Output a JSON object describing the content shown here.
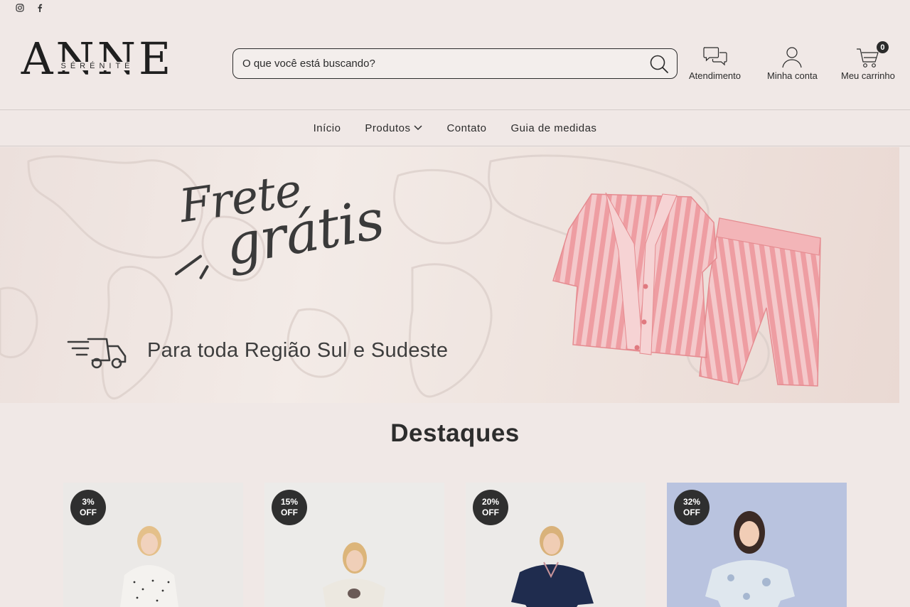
{
  "social": {
    "instagram_icon": "instagram-icon",
    "facebook_icon": "facebook-icon"
  },
  "logo": {
    "main": "ANNE",
    "sub": "SÉRÉNITÉ"
  },
  "search": {
    "placeholder": "O que você está buscando?"
  },
  "header": {
    "support_label": "Atendimento",
    "account_label": "Minha conta",
    "cart_label": "Meu carrinho",
    "cart_count": "0"
  },
  "nav": {
    "items": [
      {
        "label": "Início"
      },
      {
        "label": "Produtos"
      },
      {
        "label": "Contato"
      },
      {
        "label": "Guia de medidas"
      }
    ]
  },
  "banner": {
    "headline_1": "Frete",
    "headline_2": "grátis",
    "subtitle": "Para toda Região Sul e Sudeste"
  },
  "featured": {
    "title": "Destaques",
    "products": [
      {
        "discount": "3%",
        "off": "OFF",
        "bg": "#ebe9e7",
        "shirt": "#f4f2ef"
      },
      {
        "discount": "15%",
        "off": "OFF",
        "bg": "#ecebe9",
        "shirt": "#ece8e0"
      },
      {
        "discount": "20%",
        "off": "OFF",
        "bg": "#eceae8",
        "shirt": "#1f2c4e"
      },
      {
        "discount": "32%",
        "off": "OFF",
        "bg": "#b9c3df",
        "shirt": "#dfe7ee"
      }
    ]
  },
  "colors": {
    "background": "#f0e8e6",
    "text": "#2b2b2b",
    "badge": "#2f2f2f",
    "pajama_pink": "#f0a2a6"
  }
}
